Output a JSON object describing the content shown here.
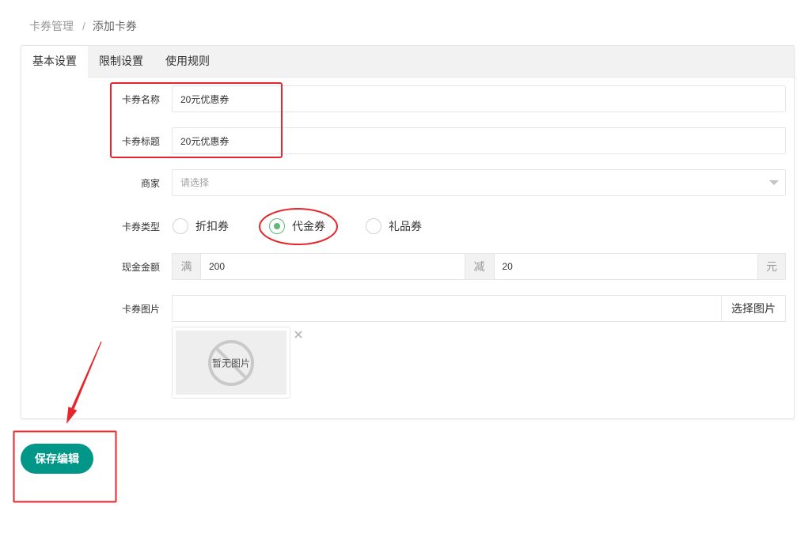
{
  "breadcrumb": {
    "items": [
      "卡券管理",
      "添加卡券"
    ],
    "separator": "/"
  },
  "tabs": [
    {
      "label": "基本设置",
      "active": true
    },
    {
      "label": "限制设置",
      "active": false
    },
    {
      "label": "使用规则",
      "active": false
    }
  ],
  "form": {
    "card_name": {
      "label": "卡券名称",
      "value": "20元优惠券"
    },
    "card_title": {
      "label": "卡券标题",
      "value": "20元优惠券"
    },
    "merchant": {
      "label": "商家",
      "placeholder": "请选择",
      "icon": "caret-down-icon"
    },
    "card_type": {
      "label": "卡券类型",
      "options": [
        {
          "label": "折扣券",
          "checked": false
        },
        {
          "label": "代金券",
          "checked": true
        },
        {
          "label": "礼品券",
          "checked": false
        }
      ]
    },
    "cash_amount": {
      "label": "现金金额",
      "full_prefix": "满",
      "full_value": "200",
      "reduce_prefix": "减",
      "reduce_value": "20",
      "unit": "元"
    },
    "card_image": {
      "label": "卡券图片",
      "button_label": "选择图片",
      "preview_text": "暂无图片",
      "preview_icon": "no-image-icon",
      "remove_icon": "close-icon"
    }
  },
  "actions": {
    "save_label": "保存编辑"
  },
  "colors": {
    "accent": "#009688",
    "radio_checked": "#5FB878",
    "annotation": "#E5262B"
  }
}
